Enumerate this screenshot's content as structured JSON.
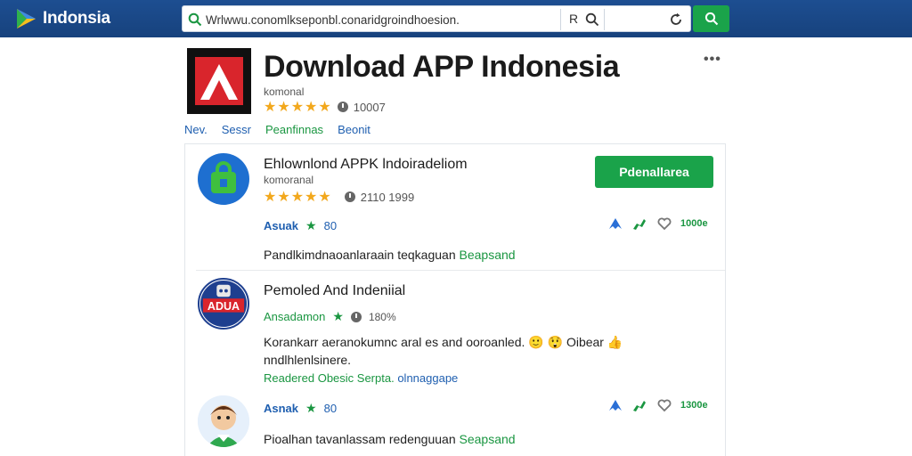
{
  "topbar": {
    "brand": "Indonsia",
    "search_value": "Wrlwwu.conomlkseponbl.conaridgroindhoesion.",
    "search_extra": "R"
  },
  "hero": {
    "title": "Download APP Indonesia",
    "subtitle": "komonal",
    "stars": "★★★★★",
    "count": "10007",
    "more": "•••"
  },
  "tabs": [
    {
      "label": "Nev."
    },
    {
      "label": "Sessr"
    },
    {
      "label": "Peanfinnas"
    },
    {
      "label": "Beonit"
    }
  ],
  "items": [
    {
      "title": "Ehlownlond APPK lndoiradeliom",
      "subtitle": "komoranal",
      "stars": "★★★★★",
      "count": "2110 1999",
      "tag": "Asuak",
      "tag_star": "★",
      "tag_count": "80",
      "desc": "Pandlkimdnaoanlaraain teqkaguan",
      "desc_green": "Beapsand",
      "actions_count": "1000e"
    },
    {
      "title": "Pemoled And Indeniial",
      "tag": "Ansadamon",
      "tag_star": "★",
      "tag_pct": "180%",
      "desc_line1": "Korankarr aeranokumnc aral es and ooroanled.",
      "desc_extra": "Oibear",
      "desc_line2": "nndlhlenlsinere.",
      "desc_green": "Readered Obesic Serpta.",
      "desc_blue": "olnnaggape",
      "icon_text": "ADUA"
    },
    {
      "tag": "Asnak",
      "tag_star": "★",
      "tag_count": "80",
      "desc": "Pioalhan tavanlassam redenguuan",
      "desc_green": "Seapsand",
      "actions_count": "1300e"
    }
  ],
  "download_button": "Pdenallarea",
  "colors": {
    "accent_green": "#1aa34a",
    "link_blue": "#1f5fb0",
    "star": "#f2a81d",
    "topbar": "#1d4e91"
  }
}
